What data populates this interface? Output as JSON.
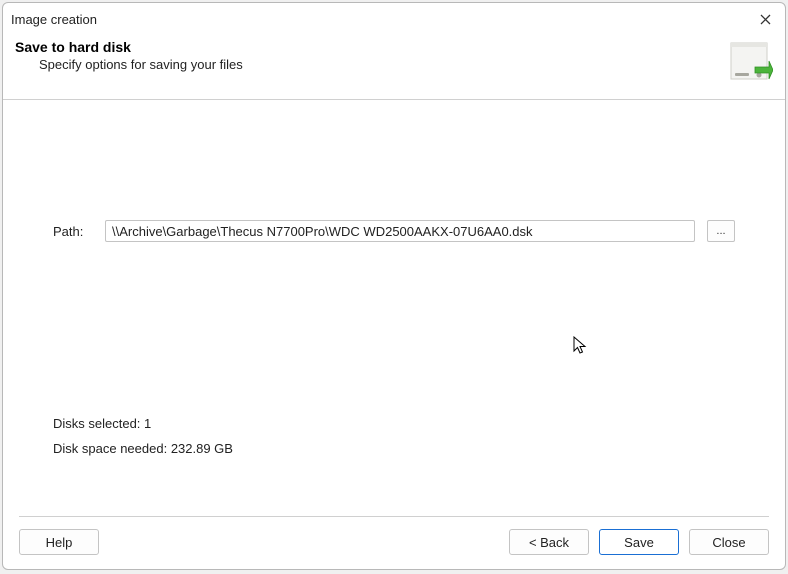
{
  "window": {
    "title": "Image creation"
  },
  "header": {
    "title": "Save to hard disk",
    "subtitle": "Specify options for saving your files"
  },
  "form": {
    "path_label": "Path:",
    "path_value": "\\\\Archive\\Garbage\\Thecus N7700Pro\\WDC WD2500AAKX-07U6AA0.dsk",
    "browse_label": "..."
  },
  "info": {
    "disks_selected_label": "Disks selected:",
    "disks_selected_value": "1",
    "space_needed_label": "Disk space needed:",
    "space_needed_value": "232.89 GB"
  },
  "footer": {
    "help": "Help",
    "back": "< Back",
    "save": "Save",
    "close": "Close"
  }
}
